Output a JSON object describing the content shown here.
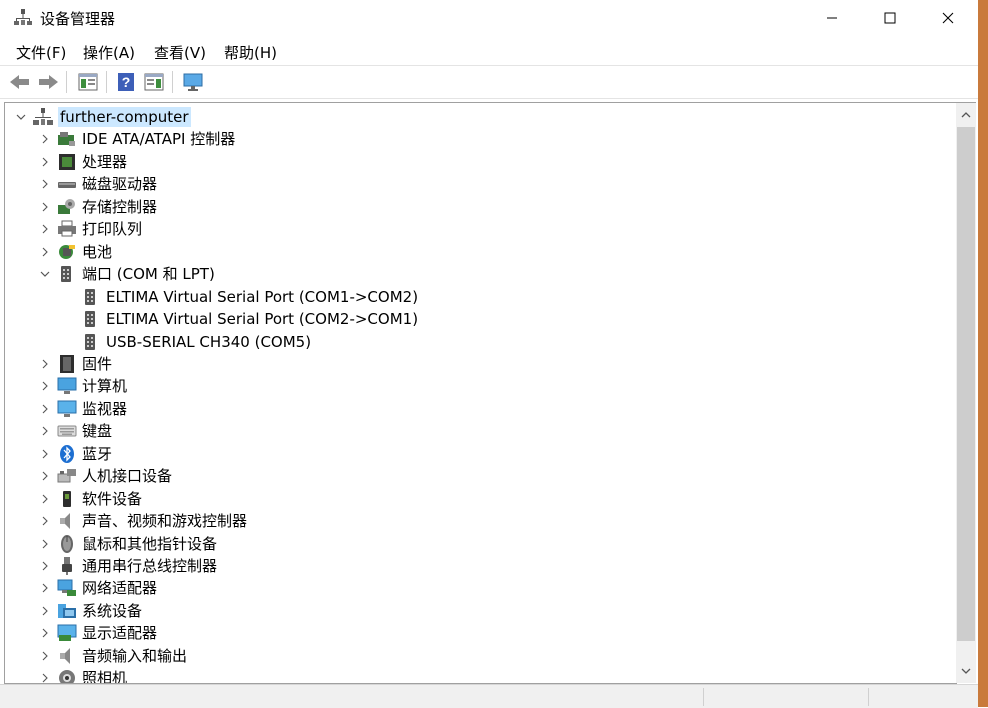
{
  "window": {
    "title": "设备管理器",
    "controls": [
      "minimize",
      "maximize",
      "close"
    ]
  },
  "menu": [
    {
      "label": "文件(F)"
    },
    {
      "label": "操作(A)"
    },
    {
      "label": "查看(V)"
    },
    {
      "label": "帮助(H)"
    }
  ],
  "toolbar": {
    "buttons": [
      "back-icon",
      "forward-icon",
      "properties-pane-icon",
      "help-icon",
      "show-pane-icon",
      "monitor-icon"
    ]
  },
  "tree": {
    "root": {
      "label": "further-computer",
      "expanded": true,
      "selected": true,
      "icon": "computer-network-icon"
    },
    "categories": [
      {
        "label": "IDE ATA/ATAPI 控制器",
        "icon": "ide-controller-icon",
        "expanded": false
      },
      {
        "label": "处理器",
        "icon": "processor-icon",
        "expanded": false
      },
      {
        "label": "磁盘驱动器",
        "icon": "disk-drive-icon",
        "expanded": false
      },
      {
        "label": "存储控制器",
        "icon": "storage-controller-icon",
        "expanded": false
      },
      {
        "label": "打印队列",
        "icon": "printer-icon",
        "expanded": false
      },
      {
        "label": "电池",
        "icon": "battery-icon",
        "expanded": false
      },
      {
        "label": "端口 (COM 和 LPT)",
        "icon": "port-icon",
        "expanded": true,
        "children": [
          {
            "label": "ELTIMA Virtual Serial Port (COM1->COM2)",
            "icon": "port-icon"
          },
          {
            "label": "ELTIMA Virtual Serial Port (COM2->COM1)",
            "icon": "port-icon"
          },
          {
            "label": "USB-SERIAL CH340 (COM5)",
            "icon": "port-icon"
          }
        ]
      },
      {
        "label": "固件",
        "icon": "firmware-icon",
        "expanded": false
      },
      {
        "label": "计算机",
        "icon": "computer-icon",
        "expanded": false
      },
      {
        "label": "监视器",
        "icon": "monitor-icon",
        "expanded": false
      },
      {
        "label": "键盘",
        "icon": "keyboard-icon",
        "expanded": false
      },
      {
        "label": "蓝牙",
        "icon": "bluetooth-icon",
        "expanded": false
      },
      {
        "label": "人机接口设备",
        "icon": "hid-icon",
        "expanded": false
      },
      {
        "label": "软件设备",
        "icon": "software-device-icon",
        "expanded": false
      },
      {
        "label": "声音、视频和游戏控制器",
        "icon": "speaker-icon",
        "expanded": false
      },
      {
        "label": "鼠标和其他指针设备",
        "icon": "mouse-icon",
        "expanded": false
      },
      {
        "label": "通用串行总线控制器",
        "icon": "usb-icon",
        "expanded": false
      },
      {
        "label": "网络适配器",
        "icon": "network-adapter-icon",
        "expanded": false
      },
      {
        "label": "系统设备",
        "icon": "system-device-icon",
        "expanded": false
      },
      {
        "label": "显示适配器",
        "icon": "display-adapter-icon",
        "expanded": false
      },
      {
        "label": "音频输入和输出",
        "icon": "audio-io-icon",
        "expanded": false
      },
      {
        "label": "照相机",
        "icon": "camera-icon",
        "expanded": false
      }
    ]
  },
  "colors": {
    "selection": "#cce8ff",
    "window_edge": "#c97a3c"
  }
}
